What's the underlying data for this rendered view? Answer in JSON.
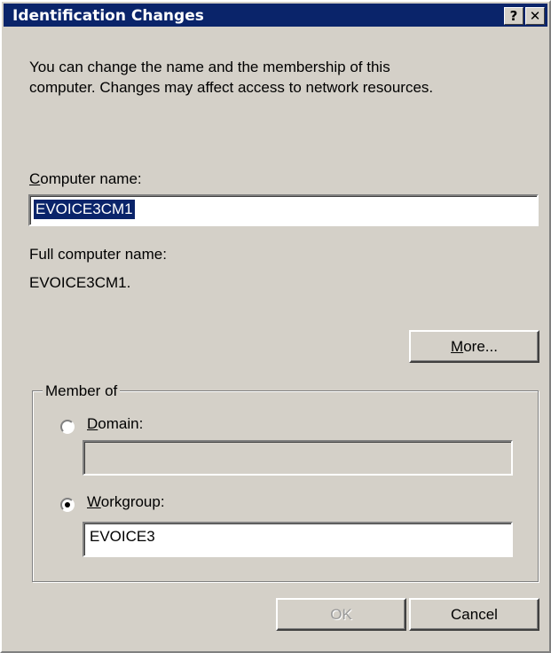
{
  "window": {
    "title": "Identification Changes",
    "help_glyph": "?",
    "close_glyph": "✕"
  },
  "description": {
    "line1": "You can change the name and the membership of this",
    "line2": "computer. Changes may affect access to network resources."
  },
  "computer_name": {
    "label_hotkey": "C",
    "label_rest": "omputer name:",
    "value": "EVOICE3CM1"
  },
  "full_name": {
    "label": "Full computer name:",
    "value": "EVOICE3CM1."
  },
  "more_button": {
    "hotkey": "M",
    "rest": "ore..."
  },
  "member_of": {
    "label": "Member of",
    "domain": {
      "hotkey": "D",
      "rest": "omain:",
      "value": "",
      "selected": false,
      "enabled": false
    },
    "workgroup": {
      "hotkey": "W",
      "rest": "orkgroup:",
      "value": "EVOICE3",
      "selected": true
    }
  },
  "buttons": {
    "ok": "OK",
    "cancel": "Cancel"
  }
}
